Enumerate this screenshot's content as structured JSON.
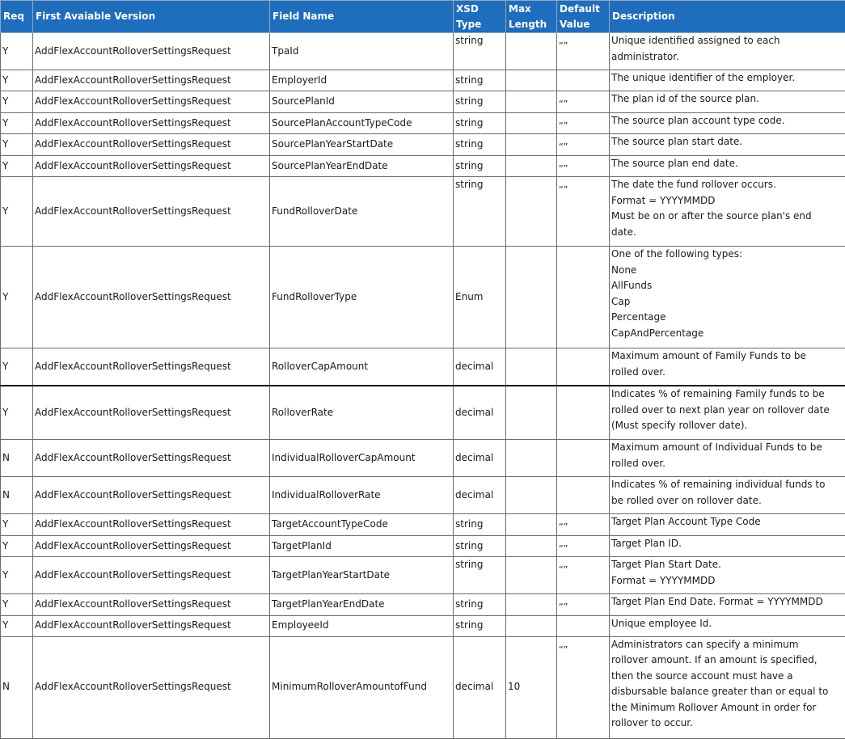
{
  "headers": {
    "req": "Req",
    "first_version": "First Avaiable Version",
    "field_name": "Field Name",
    "xsd_type": "XSD Type",
    "max_length_1": "Max",
    "max_length_2": "Length",
    "default_value_1": "Default",
    "default_value_2": "Value",
    "description": "Description"
  },
  "rows": [
    {
      "req": "Y",
      "version": "AddFlexAccountRolloverSettingsRequest",
      "field": "TpaId",
      "type": "string",
      "max": "",
      "default": "“”",
      "desc": [
        "Unique identified assigned to each",
        "administrator."
      ]
    },
    {
      "req": "Y",
      "version": "AddFlexAccountRolloverSettingsRequest",
      "field": "EmployerId",
      "type": "string",
      "max": "",
      "default": "",
      "desc": [
        "The unique identifier of the employer."
      ]
    },
    {
      "req": "Y",
      "version": "AddFlexAccountRolloverSettingsRequest",
      "field": "SourcePlanId",
      "type": "string",
      "max": "",
      "default": "“”",
      "desc": [
        "The plan id of the source plan."
      ]
    },
    {
      "req": "Y",
      "version": "AddFlexAccountRolloverSettingsRequest",
      "field": "SourcePlanAccountTypeCode",
      "type": "string",
      "max": "",
      "default": "“”",
      "desc": [
        "The source plan account type code."
      ]
    },
    {
      "req": "Y",
      "version": "AddFlexAccountRolloverSettingsRequest",
      "field": "SourcePlanYearStartDate",
      "type": "string",
      "max": "",
      "default": "“”",
      "desc": [
        "The source plan start date."
      ]
    },
    {
      "req": "Y",
      "version": "AddFlexAccountRolloverSettingsRequest",
      "field": "SourcePlanYearEndDate",
      "type": "string",
      "max": "",
      "default": "“”",
      "desc": [
        "The source plan end date."
      ]
    },
    {
      "req": "Y",
      "version": "AddFlexAccountRolloverSettingsRequest",
      "field": "FundRolloverDate",
      "type": "string",
      "max": "",
      "default": "“”",
      "desc": [
        "The date the fund rollover occurs.",
        "Format = YYYYMMDD",
        "Must be on or after the source plan's end",
        "date."
      ]
    },
    {
      "req": "Y",
      "version": "AddFlexAccountRolloverSettingsRequest",
      "field": "FundRolloverType",
      "type": "Enum",
      "max": "",
      "default": "",
      "desc": [
        "One of the following types:",
        "None",
        "AllFunds",
        "Cap",
        "Percentage",
        "CapAndPercentage"
      ]
    },
    {
      "req": "Y",
      "version": "AddFlexAccountRolloverSettingsRequest",
      "field": "RolloverCapAmount",
      "type": "decimal",
      "max": "",
      "default": "",
      "desc": [
        "Maximum amount of Family Funds to be",
        "rolled over."
      ]
    },
    {
      "req": "Y",
      "version": "AddFlexAccountRolloverSettingsRequest",
      "field": "RolloverRate",
      "type": "decimal",
      "max": "",
      "default": "",
      "desc": [
        "Indicates % of remaining Family funds to be",
        "rolled over to next plan year on rollover date",
        "(Must specify rollover date)."
      ]
    },
    {
      "req": "N",
      "version": "AddFlexAccountRolloverSettingsRequest",
      "field": "IndividualRolloverCapAmount",
      "type": "decimal",
      "max": "",
      "default": "",
      "desc": [
        "Maximum amount of Individual Funds to be",
        "rolled over."
      ]
    },
    {
      "req": "N",
      "version": "AddFlexAccountRolloverSettingsRequest",
      "field": "IndividualRolloverRate",
      "type": "decimal",
      "max": "",
      "default": "",
      "desc": [
        "Indicates % of remaining individual funds to",
        "be rolled over on rollover date."
      ]
    },
    {
      "req": "Y",
      "version": "AddFlexAccountRolloverSettingsRequest",
      "field": "TargetAccountTypeCode",
      "type": "string",
      "max": "",
      "default": "“”",
      "desc": [
        "Target Plan Account Type Code"
      ]
    },
    {
      "req": "Y",
      "version": "AddFlexAccountRolloverSettingsRequest",
      "field": "TargetPlanId",
      "type": "string",
      "max": "",
      "default": "“”",
      "desc": [
        "Target Plan ID."
      ]
    },
    {
      "req": "Y",
      "version": "AddFlexAccountRolloverSettingsRequest",
      "field": "TargetPlanYearStartDate",
      "type": "string",
      "max": "",
      "default": "“”",
      "desc": [
        "Target Plan Start Date.",
        "Format = YYYYMMDD"
      ]
    },
    {
      "req": "Y",
      "version": "AddFlexAccountRolloverSettingsRequest",
      "field": "TargetPlanYearEndDate",
      "type": "string",
      "max": "",
      "default": "“”",
      "desc": [
        "Target Plan End Date. Format = YYYYMMDD"
      ]
    },
    {
      "req": "Y",
      "version": "AddFlexAccountRolloverSettingsRequest",
      "field": "EmployeeId",
      "type": "string",
      "max": "",
      "default": "",
      "desc": [
        "Unique employee Id."
      ]
    },
    {
      "req": "N",
      "version": "AddFlexAccountRolloverSettingsRequest",
      "field": "MinimumRolloverAmountofFund",
      "type": "decimal",
      "max": "10",
      "default": "“”",
      "desc": [
        "Administrators can specify a minimum",
        "rollover amount.  If an amount is specified,",
        "then the source account must have a",
        "disbursable balance greater than or equal to",
        "the Minimum Rollover Amount in order for",
        "rollover to occur."
      ]
    }
  ]
}
